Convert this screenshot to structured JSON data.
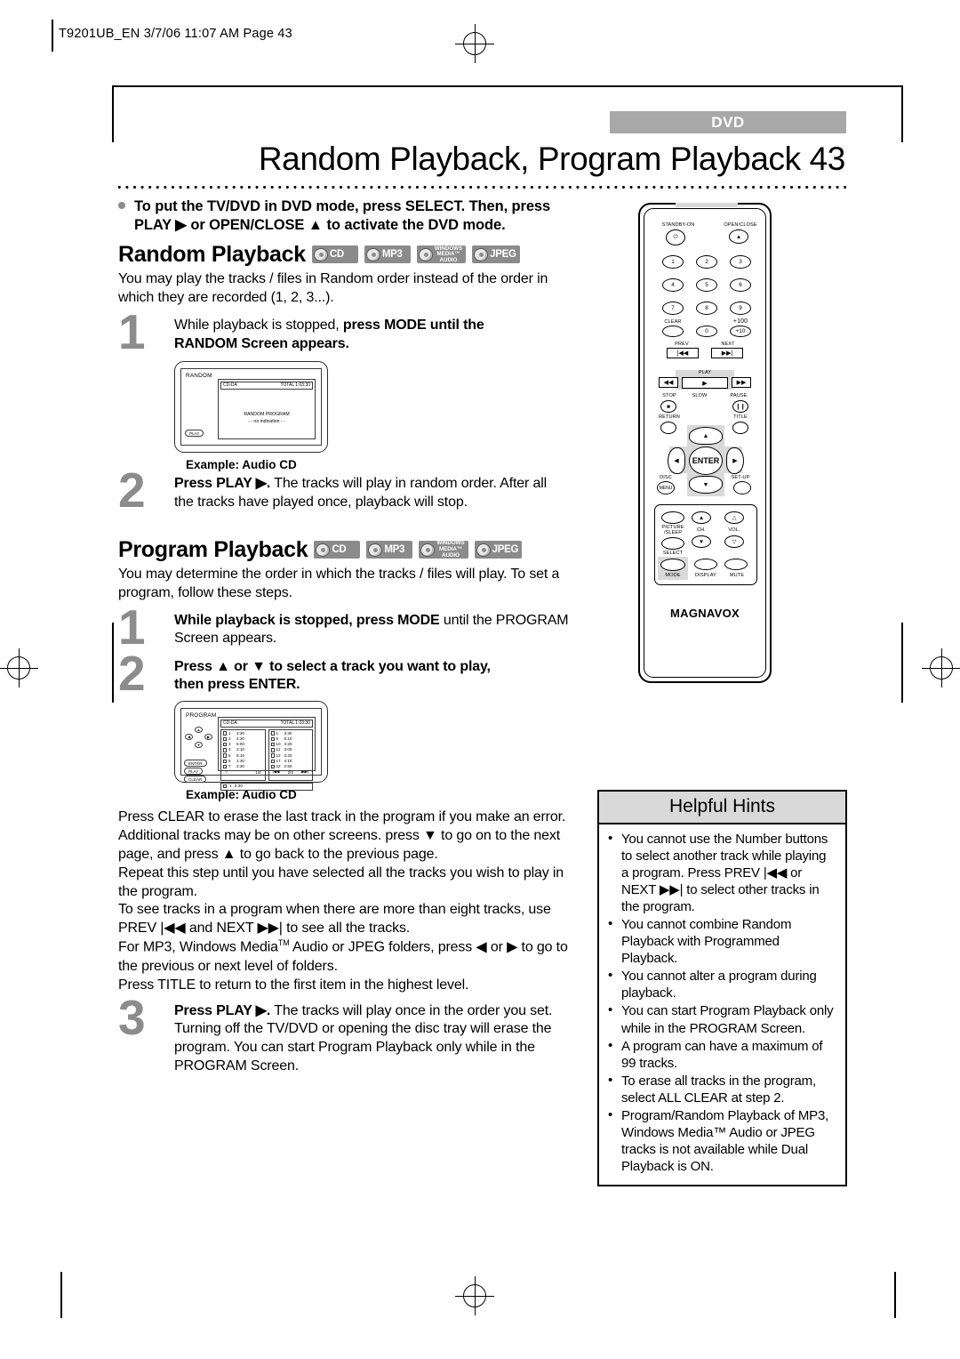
{
  "header": {
    "filestamp": "T9201UB_EN 3/7/06 11:07 AM Page 43"
  },
  "title": {
    "badge": "DVD",
    "heading": "Random Playback, Program Playback  43"
  },
  "intro": {
    "bullet": "To put the TV/DVD in DVD mode, press SELECT. Then, press PLAY ▶ or OPEN/CLOSE ▲ to activate the DVD mode."
  },
  "media_badges": [
    {
      "name": "cd",
      "label": "CD"
    },
    {
      "name": "mp3",
      "label": "MP3"
    },
    {
      "name": "windows-media-audio",
      "label": "WINDOWS MEDIA™ AUDIO",
      "line1": "WINDOWS",
      "line2": "MEDIA™",
      "line3": "AUDIO"
    },
    {
      "name": "jpeg",
      "label": "JPEG"
    }
  ],
  "random": {
    "heading": "Random Playback",
    "intro": "You may play the tracks / files in Random order instead of the order in which they are recorded (1, 2, 3...).",
    "step1_num": "1",
    "step1_plain_a": "While playback is stopped, ",
    "step1_bold_a": "press MODE until the",
    "step1_bold_b": "RANDOM Screen appears.",
    "example_caption": "Example: Audio CD",
    "step2_num": "2",
    "step2_bold": "Press PLAY ▶.",
    "step2_rest": " The tracks will play in random order. After all the tracks have played once, playback will stop."
  },
  "random_screen": {
    "screen_label": "RANDOM",
    "disc_type": "CD-DA",
    "total": "TOTAL 1:03:30",
    "mid_line1": "RANDOM  PROGRAM",
    "mid_line2": "- -  no  indication  - -",
    "play_pill": "PLAY"
  },
  "program": {
    "heading": "Program Playback",
    "intro": "You may determine the order in which the tracks / files will play. To set a program, follow these steps.",
    "step1_num": "1",
    "step1_bold": "While playback is stopped, press MODE",
    "step1_plain": " until the PROGRAM Screen appears.",
    "step2_num": "2",
    "step2_bold_a": "Press ▲ or ▼ to select a track you want to play,",
    "step2_bold_b": "then press ENTER.",
    "example_caption": "Example: Audio CD",
    "para1": "Press CLEAR to erase the last track in the program if you make an error.",
    "para2": "Additional tracks may be on other screens. press ▼ to go on to the next page, and press ▲ to go back to the previous page.",
    "para3": "Repeat this step until you have selected all the tracks you wish to play in the program.",
    "para4": "To see tracks in a program when there are more than eight tracks, use PREV |◀◀ and NEXT ▶▶| to see all the tracks.",
    "para5_a": "For MP3, Windows Media",
    "para5_tm": "TM",
    "para5_b": " Audio or JPEG folders, press ◀ or ▶ to go to the previous or next level of folders.",
    "para6": "Press TITLE to return to the first item in the highest level.",
    "step3_num": "3",
    "step3_bold": "Press PLAY ▶.",
    "step3_rest": " The tracks will play once in the order you set. Turning off the TV/DVD or opening the disc tray will erase the program. You can start Program Playback only while in the PROGRAM Screen."
  },
  "program_screen": {
    "screen_label": "PROGRAM",
    "disc_type": "CD-DA",
    "total": "TOTAL 1:03:30",
    "page_indicator_left": "1/4",
    "page_indicator_right": "2/3",
    "prev_icon": "|◀◀",
    "next_icon": "▶▶|",
    "enter_pill": "ENTER",
    "play_pill": "PLAY",
    "clear_pill": "CLEAR",
    "bottom_row": {
      "track": "1",
      "time": "3:30"
    },
    "left_tracks": [
      {
        "track": "1",
        "time": "3:30"
      },
      {
        "track": "2",
        "time": "4:30"
      },
      {
        "track": "3",
        "time": "5:00"
      },
      {
        "track": "4",
        "time": "3:10"
      },
      {
        "track": "5",
        "time": "5:10"
      },
      {
        "track": "6",
        "time": "1:30"
      },
      {
        "track": "7",
        "time": "2:30"
      }
    ],
    "right_tracks": [
      {
        "track": "1",
        "time": "3:30"
      },
      {
        "track": "5",
        "time": "5:10"
      },
      {
        "track": "10",
        "time": "4:20"
      },
      {
        "track": "11",
        "time": "3:00"
      },
      {
        "track": "12",
        "time": "3:20"
      },
      {
        "track": "17",
        "time": "4:10"
      },
      {
        "track": "22",
        "time": "2:50"
      }
    ]
  },
  "hints": {
    "title": "Helpful Hints",
    "items": [
      "You cannot use the Number buttons to select another track while playing a program. Press PREV |◀◀ or NEXT ▶▶| to select other tracks in the program.",
      "You cannot combine Random Playback with Programmed Playback.",
      "You cannot alter a program during playback.",
      "You can start Program Playback only while in the PROGRAM Screen.",
      "A program can have a maximum of 99 tracks.",
      "To erase all tracks in the program, select ALL CLEAR at step 2.",
      "Program/Random Playback of MP3, Windows Media™ Audio or JPEG tracks is not available while Dual Playback is ON."
    ]
  },
  "remote": {
    "brand": "MAGNAVOX",
    "standby_label": "STANDBY-ON",
    "open_close_label": "OPEN/CLOSE",
    "numbers": [
      "1",
      "2",
      "3",
      "4",
      "5",
      "6",
      "7",
      "8",
      "9"
    ],
    "clear_label": "CLEAR",
    "zero_label": "0",
    "plus100_label": "+100",
    "plus10_label": "+10",
    "prev_label": "PREV",
    "next_label": "NEXT",
    "play_label": "PLAY",
    "stop_label": "STOP",
    "slow_label": "SLOW",
    "pause_label": "PAUSE",
    "return_label": "RETURN",
    "title_label": "TITLE",
    "enter_label": "ENTER",
    "disc_label": "DISC",
    "disc_sub": "MENU",
    "setup_label": "SET-UP",
    "picture_label": "PICTURE",
    "sleep_label": "/SLEEP",
    "select_label": "SELECT",
    "ch_label": "CH.",
    "vol_label": "VOL.",
    "mode_label": "MODE",
    "display_label": "DISPLAY",
    "mute_label": "MUTE"
  }
}
